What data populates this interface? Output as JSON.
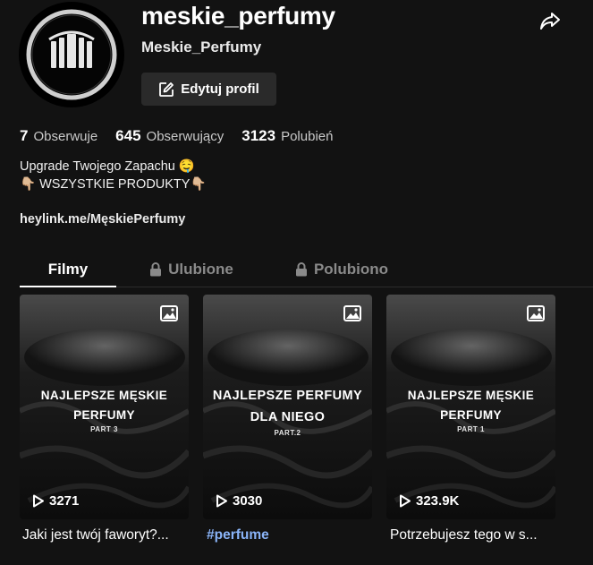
{
  "profile": {
    "username": "meskie_perfumy",
    "nickname": "Meskie_Perfumy",
    "edit_label": "Edytuj profil"
  },
  "stats": [
    {
      "value": "7",
      "label": "Obserwuje"
    },
    {
      "value": "645",
      "label": "Obserwujący"
    },
    {
      "value": "3123",
      "label": "Polubień"
    }
  ],
  "bio": {
    "line1": "Upgrade Twojego Zapachu 🤤",
    "line2": "👇🏼 WSZYSTKIE PRODUKTY👇🏼",
    "link": "heylink.me/MęskiePerfumy"
  },
  "tabs": [
    {
      "label": "Filmy",
      "locked": false,
      "active": true
    },
    {
      "label": "Ulubione",
      "locked": true,
      "active": false
    },
    {
      "label": "Polubiono",
      "locked": true,
      "active": false
    }
  ],
  "videos": [
    {
      "title_line1": "NAJLEPSZE MĘSKIE",
      "title_line2": "PERFUMY",
      "part": "PART 3",
      "views": "3271",
      "caption": "Jaki jest twój faworyt?..."
    },
    {
      "title_line1": "NAJLEPSZE PERFUMY",
      "title_line2": "DLA NIEGO",
      "part": "PART.2",
      "views": "3030",
      "caption": "#perfume"
    },
    {
      "title_line1": "NAJLEPSZE MĘSKIE",
      "title_line2": "PERFUMY",
      "part": "PART 1",
      "views": "323.9K",
      "caption": "Potrzebujesz tego w s..."
    }
  ],
  "icons": {
    "share": "share-icon",
    "edit": "edit-icon",
    "lock": "lock-icon",
    "photo": "photo-icon",
    "play": "play-icon"
  },
  "colors": {
    "background": "#121212",
    "button": "#2a2a2a",
    "hashtag": "#8ab4f8"
  }
}
